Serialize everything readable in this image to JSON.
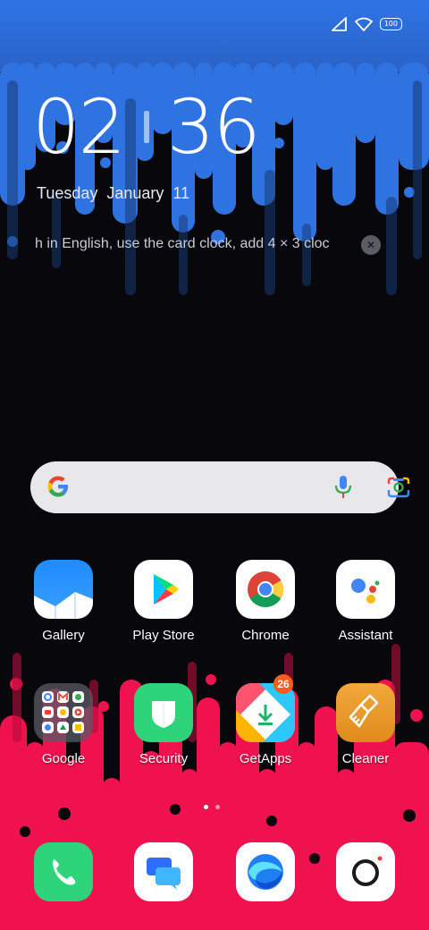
{
  "status_bar": {
    "battery": "100",
    "icons": [
      "signal-icon",
      "wifi-icon",
      "battery-icon"
    ]
  },
  "clock": {
    "hours": "02",
    "minutes": "36"
  },
  "date": "Tuesday January 11",
  "notification": {
    "text": "h in English, use the card clock, add 4 × 3 cloc",
    "dismiss_icon": "close-icon"
  },
  "search_bar": {
    "icons": [
      "google-logo",
      "mic-icon",
      "lens-icon"
    ]
  },
  "apps_row1": [
    {
      "label": "Gallery"
    },
    {
      "label": "Play Store"
    },
    {
      "label": "Chrome"
    },
    {
      "label": "Assistant"
    }
  ],
  "apps_row2": [
    {
      "label": "Google"
    },
    {
      "label": "Security"
    },
    {
      "label": "GetApps",
      "badge": "26"
    },
    {
      "label": "Cleaner"
    }
  ],
  "dock": [
    "phone-icon",
    "messages-icon",
    "browser-icon",
    "camera-icon"
  ],
  "page_indicator": {
    "pages": 2,
    "current": 1
  },
  "colors": {
    "top_wall": "#2f72e2",
    "bottom_wall": "#f0124f",
    "background": "#08080c"
  }
}
